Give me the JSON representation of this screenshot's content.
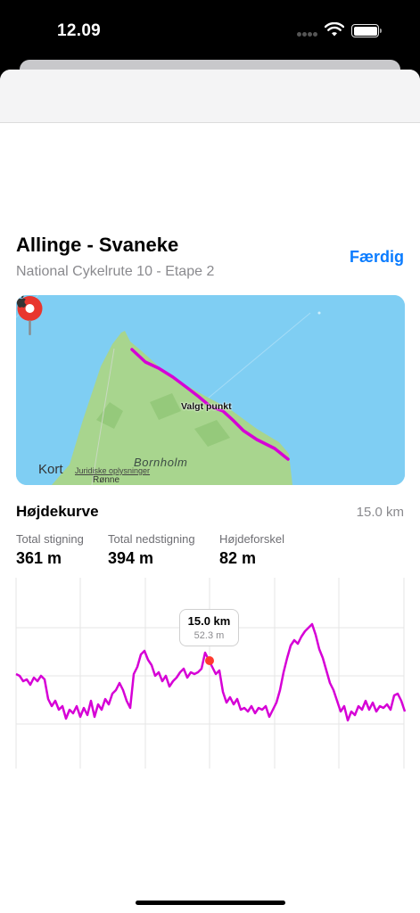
{
  "status_bar": {
    "time": "12.09"
  },
  "route": {
    "title": "Allinge - Svaneke",
    "subtitle": "National Cykelrute 10 - Etape 2",
    "done_label": "Færdig"
  },
  "map": {
    "brand": "Kort",
    "legal": "Juridiske oplysninger",
    "place_label": "Bornholm",
    "place_label_2": "Rønne",
    "pin_label": "Valgt punkt",
    "route_color": "#d600d6",
    "pin_color": "#e8362e"
  },
  "elevation": {
    "title": "Højdekurve",
    "distance": "15.0 km",
    "stats": [
      {
        "label": "Total stigning",
        "value": "361 m"
      },
      {
        "label": "Total nedstigning",
        "value": "394 m"
      },
      {
        "label": "Højdeforskel",
        "value": "82 m"
      }
    ],
    "tooltip": {
      "distance": "15.0 km",
      "elevation": "52.3 m"
    }
  },
  "colors": {
    "accent": "#0a7cff",
    "route": "#d600d6",
    "marker": "#ff3b30"
  }
}
